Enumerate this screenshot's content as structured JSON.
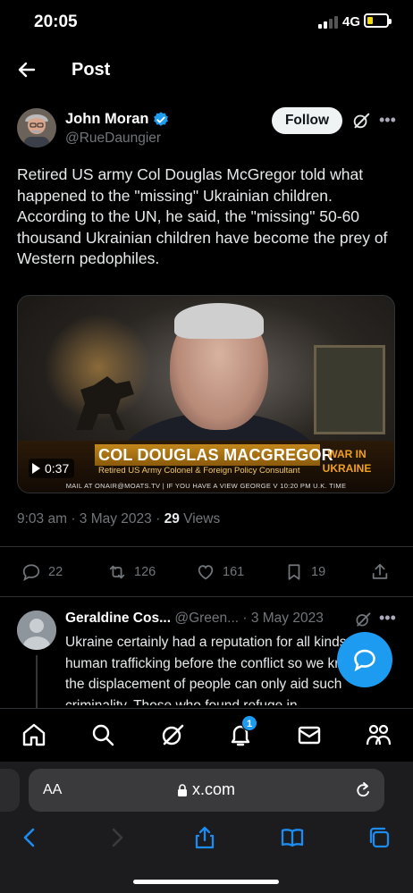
{
  "status_bar": {
    "time": "20:05",
    "network": "4G"
  },
  "header": {
    "title": "Post",
    "back_icon": "arrow-left-icon"
  },
  "post": {
    "author": {
      "name": "John Moran",
      "handle": "@RueDaungier",
      "verified": true
    },
    "follow_label": "Follow",
    "text": "Retired US army Col Douglas McGregor told what happened to the \"missing\" Ukrainian children. According to the UN, he said, the \"missing\" 50-60 thousand Ukrainian children have become the prey of Western pedophiles.",
    "video": {
      "duration": "0:37",
      "lower_third_name": "COL DOUGLAS MACGREGOR",
      "lower_third_subtitle": "Retired US Army Colonel & Foreign Policy Consultant",
      "tag_line1": "WAR IN",
      "tag_line2": "UKRAINE",
      "ticker": "MAIL AT ONAIR@MOATS.TV    |    IF YOU HAVE A VIEW GEORGE V     10:20 PM U.K. TIME"
    },
    "meta": {
      "time": "9:03 am",
      "date": "3 May 2023",
      "views_count": "29",
      "views_label": "Views"
    },
    "actions": {
      "replies": "22",
      "reposts": "126",
      "likes": "161",
      "bookmarks": "19"
    }
  },
  "reply": {
    "name": "Geraldine Cos...",
    "handle": "@Green...",
    "date": "· 3 May 2023",
    "text": "Ukraine certainly had a reputation for all kinds of human trafficking before the conflict so we know that the displacement of people can only aid such criminality. Those who found refuge in"
  },
  "tab_bar": {
    "notification_badge": "1"
  },
  "safari": {
    "aa_label": "AA",
    "url": "x.com"
  },
  "colors": {
    "accent": "#1d9bf0",
    "background": "#000000",
    "muted": "#71767b",
    "battery": "#f5d90a"
  }
}
